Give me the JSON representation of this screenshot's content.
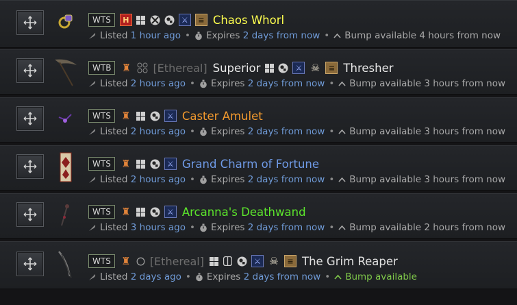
{
  "colors": {
    "unique": "#c7b377",
    "set": "#33ff33",
    "rare": "#ffff4f",
    "magic": "#6f8ff0",
    "crafted": "#f39a2e",
    "white": "#e8e8e8"
  },
  "listings": [
    {
      "tag": "WTS",
      "ethereal_label": "",
      "superior_label": "",
      "name": "Chaos Whorl",
      "name_color": "#ffff4f",
      "icons": [
        "hardcore-icon",
        "windows-icon",
        "xbox-icon",
        "playstation-icon",
        "ladder-icon",
        "season-badge-icon"
      ],
      "listed_prefix": "Listed",
      "listed_time": "1 hour ago",
      "expires_prefix": "Expires",
      "expires_time": "2 days from now",
      "bump_text": "Bump available 4 hours from now",
      "bump_ready": false,
      "thumb": "ring"
    },
    {
      "tag": "WTB",
      "ethereal_label": "[Ethereal]",
      "superior_label": "Superior",
      "name": "Thresher",
      "name_color": "#e8e8e8",
      "icons": [
        "softcore-icon",
        "windows-icon",
        "playstation-icon",
        "ladder-icon",
        "skull-icon",
        "season-badge-icon"
      ],
      "listed_prefix": "Listed",
      "listed_time": "2 hours ago",
      "expires_prefix": "Expires",
      "expires_time": "2 days from now",
      "bump_text": "Bump available 3 hours from now",
      "bump_ready": false,
      "thumb": "scythe"
    },
    {
      "tag": "WTS",
      "ethereal_label": "",
      "superior_label": "",
      "name": "Caster Amulet",
      "name_color": "#f39a2e",
      "icons": [
        "softcore-icon",
        "windows-icon",
        "playstation-icon",
        "ladder-icon"
      ],
      "listed_prefix": "Listed",
      "listed_time": "2 hours ago",
      "expires_prefix": "Expires",
      "expires_time": "2 days from now",
      "bump_text": "Bump available 3 hours from now",
      "bump_ready": false,
      "thumb": "amulet"
    },
    {
      "tag": "WTS",
      "ethereal_label": "",
      "superior_label": "",
      "name": "Grand Charm of Fortune",
      "name_color": "#6f9ae6",
      "icons": [
        "softcore-icon",
        "windows-icon",
        "playstation-icon",
        "ladder-icon"
      ],
      "listed_prefix": "Listed",
      "listed_time": "2 hours ago",
      "expires_prefix": "Expires",
      "expires_time": "2 days from now",
      "bump_text": "Bump available 3 hours from now",
      "bump_ready": false,
      "thumb": "charm"
    },
    {
      "tag": "WTS",
      "ethereal_label": "",
      "superior_label": "",
      "name": "Arcanna's Deathwand",
      "name_color": "#5ce62c",
      "icons": [
        "softcore-icon",
        "windows-icon",
        "playstation-icon",
        "ladder-icon"
      ],
      "listed_prefix": "Listed",
      "listed_time": "3 hours ago",
      "expires_prefix": "Expires",
      "expires_time": "2 days from now",
      "bump_text": "Bump available 2 hours from now",
      "bump_ready": false,
      "thumb": "wand"
    },
    {
      "tag": "WTS",
      "ethereal_label": "[Ethereal]",
      "superior_label": "",
      "name": "The Grim Reaper",
      "name_color": "#e0e0e0",
      "icons": [
        "softcore-icon",
        "non-ethereal-circle-icon",
        "windows-icon",
        "switch-icon",
        "playstation-icon",
        "ladder-icon",
        "skull-icon",
        "season-badge-icon"
      ],
      "listed_prefix": "Listed",
      "listed_time": "2 days ago",
      "expires_prefix": "Expires",
      "expires_time": "2 days from now",
      "bump_text": "Bump available",
      "bump_ready": true,
      "thumb": "scythe2"
    }
  ]
}
